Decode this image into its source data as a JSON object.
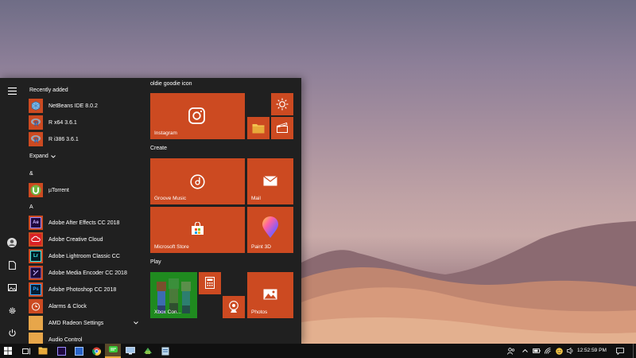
{
  "recent": {
    "title": "Recently added",
    "apps": [
      {
        "label": "NetBeans IDE 8.0.2",
        "icon": "netbeans-icon"
      },
      {
        "label": "R x64 3.6.1",
        "icon": "r-icon"
      },
      {
        "label": "R i386 3.6.1",
        "icon": "r-icon"
      }
    ],
    "expand_label": "Expand"
  },
  "groups": [
    {
      "header": "&",
      "apps": [
        {
          "label": "µTorrent",
          "icon": "utorrent-icon"
        }
      ]
    },
    {
      "header": "A",
      "apps": [
        {
          "label": "Adobe After Effects CC 2018",
          "icon": "after-effects-icon",
          "abbr": "Ae"
        },
        {
          "label": "Adobe Creative Cloud",
          "icon": "creative-cloud-icon"
        },
        {
          "label": "Adobe Lightroom Classic CC",
          "icon": "lightroom-icon",
          "abbr": "Lr"
        },
        {
          "label": "Adobe Media Encoder CC 2018",
          "icon": "media-encoder-icon"
        },
        {
          "label": "Adobe Photoshop CC 2018",
          "icon": "photoshop-icon",
          "abbr": "Ps"
        },
        {
          "label": "Alarms & Clock",
          "icon": "alarm-clock-icon"
        },
        {
          "label": "AMD Radeon Settings",
          "icon": "folder-icon"
        },
        {
          "label": "Audio Control",
          "icon": "folder-icon"
        }
      ]
    }
  ],
  "tile_sections": {
    "section1": "oldie goodie icon",
    "section2": "Create",
    "section3": "Play"
  },
  "tiles": {
    "instagram": "Instagram",
    "groove": "Groove Music",
    "mail": "Mail",
    "store": "Microsoft Store",
    "paint3d": "Paint 3D",
    "xbox": "Xbox Con...",
    "photos": "Photos"
  },
  "taskbar": {
    "clock": "12:52:59 PM"
  },
  "colors": {
    "tile": "#cc4a21",
    "menu_bg": "#202020",
    "taskbar": "#101010"
  }
}
